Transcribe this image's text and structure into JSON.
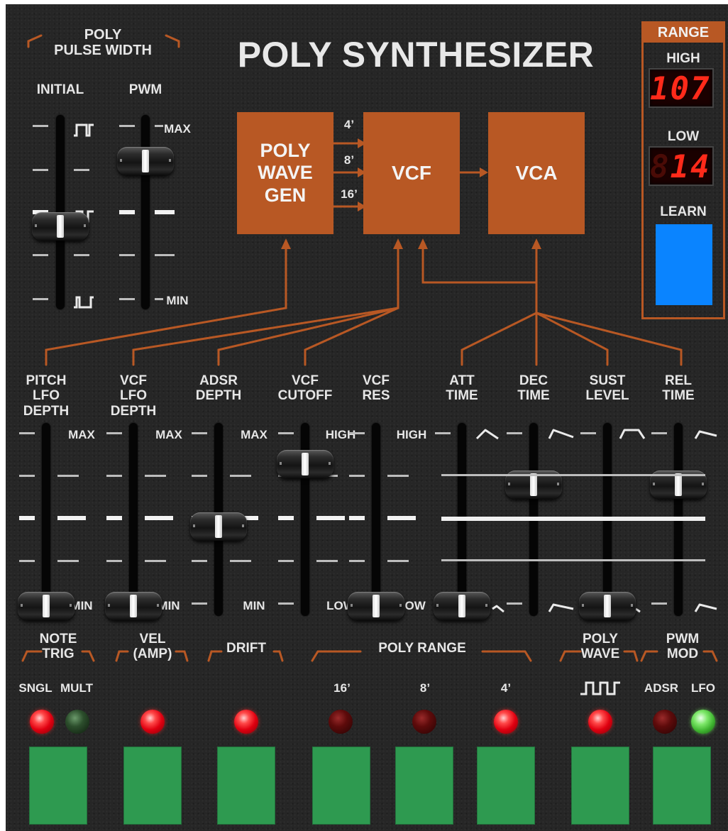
{
  "title": "POLY SYNTHESIZER",
  "pulse_width": {
    "section_label": "POLY\nPULSE WIDTH",
    "initial_label": "INITIAL",
    "pwm_label": "PWM",
    "max_label": "MAX",
    "min_label": "MIN",
    "initial_level": 0.42,
    "pwm_level": 0.77
  },
  "signal_flow": {
    "wave_gen": "POLY\nWAVE\nGEN",
    "vcf": "VCF",
    "vca": "VCA",
    "feet": [
      "4’",
      "8’",
      "16’"
    ]
  },
  "range": {
    "title": "RANGE",
    "high_label": "HIGH",
    "high_value": "107",
    "low_label": "LOW",
    "low_value": "14",
    "learn_label": "LEARN",
    "learn_color": "#0a84ff"
  },
  "sliders": [
    {
      "label": "PITCH\nLFO\nDEPTH",
      "max": "MAX",
      "min": "MIN",
      "level": 0.0
    },
    {
      "label": "VCF\nLFO\nDEPTH",
      "max": "MAX",
      "min": "MIN",
      "level": 0.0
    },
    {
      "label": "ADSR\nDEPTH",
      "max": "MAX",
      "min": "MIN",
      "level": 0.46
    },
    {
      "label": "VCF\nCUTOFF",
      "max": "HIGH",
      "min": "LOW",
      "level": 0.82
    },
    {
      "label": "VCF\nRES",
      "max": "HIGH",
      "min": "LOW",
      "level": 0.0
    },
    {
      "label": "ATT\nTIME",
      "level": 0.0
    },
    {
      "label": "DEC\nTIME",
      "level": 0.7
    },
    {
      "label": "SUST\nLEVEL",
      "level": 0.0
    },
    {
      "label": "REL\nTIME",
      "level": 0.7
    }
  ],
  "switch_groups": {
    "note_trig": "NOTE\nTRIG",
    "vel_amp": "VEL\n(AMP)",
    "drift": "DRIFT",
    "poly_range": "POLY RANGE",
    "poly_wave": "POLY\nWAVE",
    "pwm_mod": "PWM\nMOD"
  },
  "switch_labels": {
    "sngl": "SNGL",
    "mult": "MULT",
    "r16": "16’",
    "r8": "8’",
    "r4": "4’",
    "wave_icon": "pulse-wave-icon",
    "adsr": "ADSR",
    "lfo": "LFO"
  },
  "leds": [
    {
      "name": "sngl",
      "state": "on",
      "color": "#ff2a2a"
    },
    {
      "name": "mult",
      "state": "off",
      "color": "#2c4e2c"
    },
    {
      "name": "vel",
      "state": "on",
      "color": "#ff2a2a"
    },
    {
      "name": "drift",
      "state": "on",
      "color": "#ff2a2a"
    },
    {
      "name": "16",
      "state": "off",
      "color": "#5e0b0b"
    },
    {
      "name": "8",
      "state": "off",
      "color": "#5e0b0b"
    },
    {
      "name": "4",
      "state": "on",
      "color": "#ff2a2a"
    },
    {
      "name": "wave",
      "state": "on",
      "color": "#ff2a2a"
    },
    {
      "name": "adsr",
      "state": "off",
      "color": "#5e0b0b"
    },
    {
      "name": "lfo",
      "state": "on",
      "color": "#7ee86a"
    }
  ],
  "colors": {
    "panel": "#262626",
    "accent_orange": "#b85824",
    "button_green": "#2e9a50",
    "led_red": "#ff2a2a",
    "display_red": "#ff2a1a"
  }
}
